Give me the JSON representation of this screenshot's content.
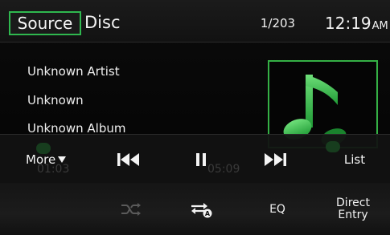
{
  "header": {
    "source_button_label": "Source",
    "source_name": "Disc",
    "track_counter": "1/203",
    "clock_time": "12:19",
    "clock_ampm": "AM"
  },
  "track": {
    "artist": "Unknown Artist",
    "title": "Unknown",
    "album": "Unknown Album",
    "album_art_icon": "music-note-icon"
  },
  "controls": {
    "more_label": "More",
    "more_icon": "triangle-down-icon",
    "previous_icon": "skip-previous-icon",
    "pause_icon": "pause-icon",
    "next_icon": "skip-next-icon",
    "list_label": "List",
    "elapsed_time": "01:03",
    "total_time": "05:09"
  },
  "bottom": {
    "shuffle_icon": "shuffle-icon",
    "repeat_icon": "repeat-all-icon",
    "repeat_badge": "A",
    "eq_label": "EQ",
    "direct_entry_line1": "Direct",
    "direct_entry_line2": "Entry"
  },
  "colors": {
    "accent_green": "#2fb84f",
    "background": "#0b0b0b",
    "text": "#f2f2f2",
    "disabled_icon": "#5a5a5a"
  }
}
